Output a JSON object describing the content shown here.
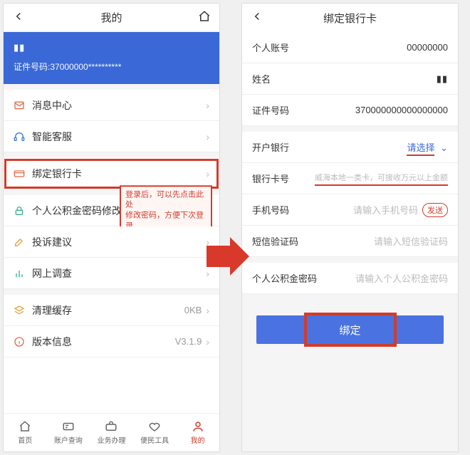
{
  "left": {
    "nav_title": "我的",
    "hero_name_mask": "▮▮",
    "hero_id_label": "证件号码:",
    "hero_id_value": "37000000**********",
    "rows": {
      "msg": "消息中心",
      "cs": "智能客服",
      "bind": "绑定银行卡",
      "pwd": "个人公积金密码修改",
      "fb": "投诉建议",
      "survey": "网上调查",
      "cache_label": "清理缓存",
      "cache_value": "0KB",
      "ver_label": "版本信息",
      "ver_value": "V3.1.9"
    },
    "tip_line1": "登录后，可以先点击此处",
    "tip_line2": "修改密码，方便下次登录",
    "tabs": {
      "home": "首页",
      "acct": "账户查询",
      "biz": "业务办理",
      "tools": "便民工具",
      "mine": "我的"
    }
  },
  "right": {
    "nav_title": "绑定银行卡",
    "rows": {
      "acct_label": "个人账号",
      "acct_value": "00000000",
      "name_label": "姓名",
      "name_mask": "▮▮",
      "id_label": "证件号码",
      "id_value": "370000000000000000",
      "bank_label": "开户银行",
      "bank_value": "请选择",
      "card_label": "银行卡号",
      "card_place": "威海本地一类卡，可接收万元以上金额",
      "phone_label": "手机号码",
      "phone_place": "请输入手机号码",
      "send_label": "发送",
      "sms_label": "短信验证码",
      "sms_place": "请输入短信验证码",
      "pwd_label": "个人公积金密码",
      "pwd_place": "请输入个人公积金密码"
    },
    "submit": "绑定"
  }
}
